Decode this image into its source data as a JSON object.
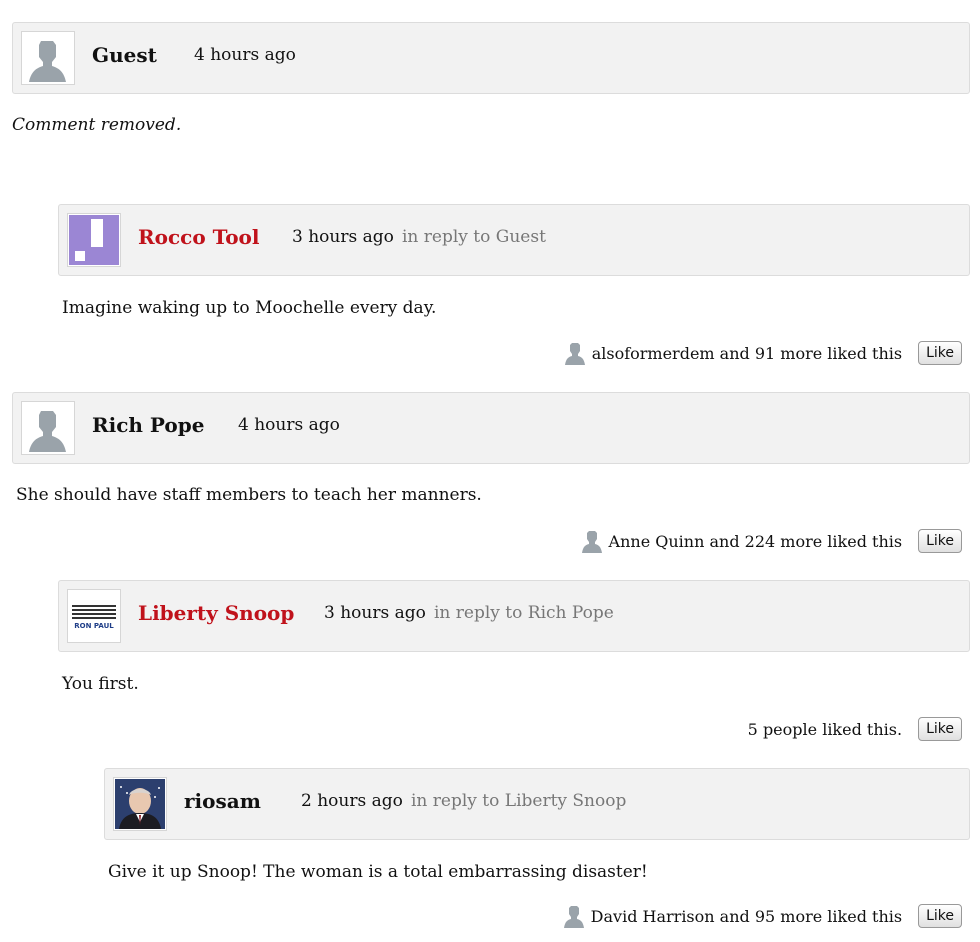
{
  "comments": [
    {
      "name": "Guest",
      "time": "4 hours ago",
      "reply": "",
      "body": "Comment removed.",
      "likes": "",
      "like_btn": ""
    },
    {
      "name": "Rocco Tool",
      "time": "3 hours ago",
      "reply": "in reply to Guest",
      "body": "Imagine waking up to Moochelle every day.",
      "likes": "alsoformerdem and 91 more liked this",
      "like_btn": "Like"
    },
    {
      "name": "Rich Pope",
      "time": "4 hours ago",
      "reply": "",
      "body": "She should have staff members to teach her manners.",
      "likes": "Anne Quinn and 224 more liked this",
      "like_btn": "Like"
    },
    {
      "name": "Liberty Snoop",
      "time": "3 hours ago",
      "reply": "in reply to Rich Pope",
      "body": "You first.",
      "likes": "5 people liked this.",
      "like_btn": "Like"
    },
    {
      "name": "riosam",
      "time": "2 hours ago",
      "reply": "in reply to Liberty Snoop",
      "body": "Give it up Snoop! The woman is a total embarrassing disaster!",
      "likes": "David Harrison and 95 more liked this",
      "like_btn": "Like"
    }
  ],
  "avatar_logo_text": "RON PAUL",
  "colors": {
    "red_name": "#c0121b",
    "header_bg": "#f2f2f2",
    "reply_gray": "#777777"
  }
}
